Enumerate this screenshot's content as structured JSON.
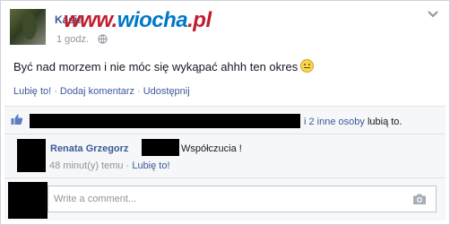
{
  "post": {
    "author_name": "Kasia",
    "watermark_left": "www.",
    "watermark_brand": "wiocha",
    "watermark_right": ".pl",
    "time": "1 godz.",
    "text": "Być nad morzem i nie móc się wykąpać ahhh ten okres",
    "actions": {
      "like": "Lubię to!",
      "comment": "Dodaj komentarz",
      "share": "Udostępnij",
      "separator": "·"
    }
  },
  "likes": {
    "others_link": "i 2 inne osoby",
    "suffix": "lubią to."
  },
  "comment": {
    "author": "Renata Grzegorz",
    "text": "Współczucia !",
    "time": "48 minut(y) temu",
    "separator": "·",
    "like": "Lubię to!"
  },
  "composer": {
    "placeholder": "Write a comment..."
  },
  "colors": {
    "link": "#3b5998",
    "meta": "#90949c",
    "ufi_bg": "#f6f7f9",
    "watermark_red": "#bf1e2e",
    "watermark_blue": "#0078c8"
  },
  "icons": [
    "privacy-globe-icon",
    "chevron-down-icon",
    "smiley-emoji-icon",
    "thumbs-up-icon",
    "camera-icon"
  ]
}
